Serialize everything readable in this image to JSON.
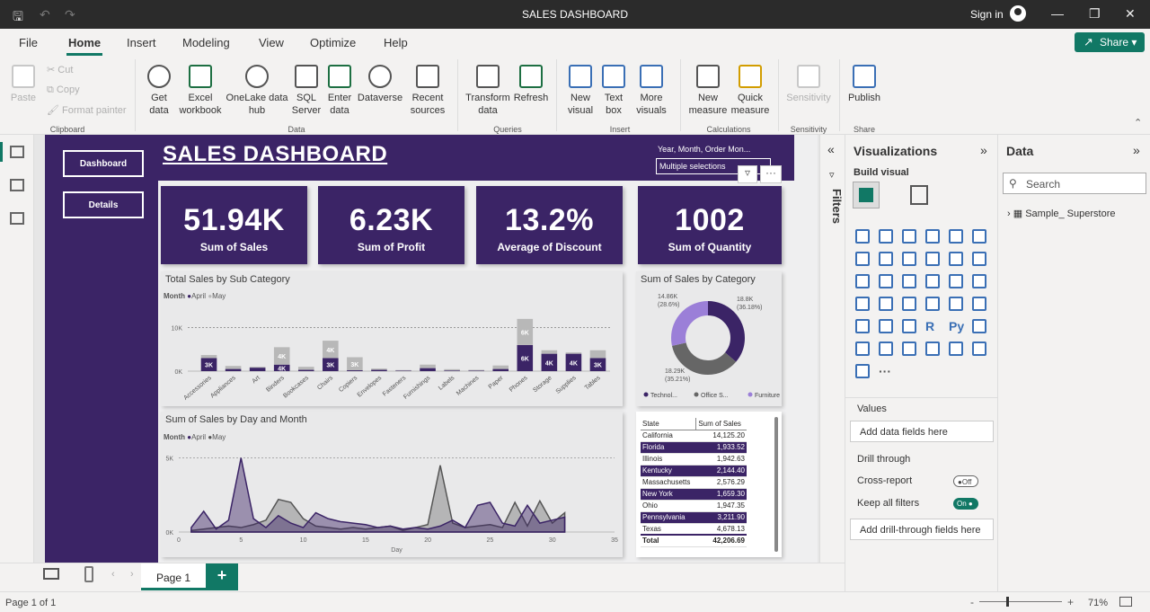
{
  "window": {
    "title": "SALES DASHBOARD",
    "sign_in": "Sign in"
  },
  "menu": {
    "tabs": [
      "File",
      "Home",
      "Insert",
      "Modeling",
      "View",
      "Optimize",
      "Help"
    ],
    "share": "Share"
  },
  "ribbon": {
    "clipboard": {
      "paste": "Paste",
      "cut": "Cut",
      "copy": "Copy",
      "format_painter": "Format painter",
      "group": "Clipboard"
    },
    "data": {
      "get_data": "Get data",
      "excel": "Excel workbook",
      "onelake": "OneLake data hub",
      "sql": "SQL Server",
      "enter": "Enter data",
      "dataverse": "Dataverse",
      "recent": "Recent sources",
      "group": "Data"
    },
    "queries": {
      "transform": "Transform data",
      "refresh": "Refresh",
      "group": "Queries"
    },
    "insert": {
      "new_visual": "New visual",
      "text_box": "Text box",
      "more_visuals": "More visuals",
      "group": "Insert"
    },
    "calculations": {
      "new_measure": "New measure",
      "quick_measure": "Quick measure",
      "group": "Calculations"
    },
    "sensitivity": {
      "label": "Sensitivity",
      "group": "Sensitivity"
    },
    "share": {
      "publish": "Publish",
      "group": "Share"
    }
  },
  "report": {
    "nav": {
      "dashboard": "Dashboard",
      "details": "Details"
    },
    "title": "SALES  DASHBOARD",
    "slicer": {
      "label": "Year, Month, Order Mon...",
      "value": "Multiple selections"
    },
    "kpis": [
      {
        "value": "51.94K",
        "label": "Sum of Sales"
      },
      {
        "value": "6.23K",
        "label": "Sum of Profit"
      },
      {
        "value": "13.2%",
        "label": "Average of Discount"
      },
      {
        "value": "1002",
        "label": "Sum of Quantity"
      }
    ]
  },
  "chart_data": [
    {
      "type": "bar",
      "title": "Total Sales by Sub Category",
      "legend_title": "Month",
      "stacked": true,
      "categories": [
        "Accessories",
        "Appliances",
        "Art",
        "Binders",
        "Bookcases",
        "Chairs",
        "Copiers",
        "Envelopes",
        "Fasteners",
        "Furnishings",
        "Labels",
        "Machines",
        "Paper",
        "Phones",
        "Storage",
        "Supplies",
        "Tables"
      ],
      "series": [
        {
          "name": "April",
          "color": "#3b2466",
          "values": [
            3000,
            500,
            800,
            1500,
            300,
            3000,
            200,
            300,
            100,
            700,
            150,
            100,
            500,
            6000,
            4000,
            4000,
            3000
          ]
        },
        {
          "name": "May",
          "color": "#b8b8b8",
          "values": [
            700,
            700,
            200,
            4000,
            700,
            4000,
            3000,
            300,
            150,
            800,
            300,
            200,
            800,
            6000,
            800,
            300,
            1800
          ]
        }
      ],
      "data_labels": [
        "3K",
        "",
        "",
        "4K",
        "",
        "3K",
        "",
        "",
        "",
        "",
        "",
        "",
        "",
        "6K",
        "4K",
        "4K",
        "3K"
      ],
      "data_labels_may": [
        "",
        "",
        "",
        "4K",
        "",
        "4K",
        "3K",
        "",
        "",
        "",
        "",
        "",
        "",
        "6K",
        "",
        "",
        ""
      ],
      "yticks": [
        "0K",
        "10K"
      ],
      "ylim": [
        0,
        14000
      ]
    },
    {
      "type": "pie",
      "title": "Sum of Sales by Category",
      "donut": true,
      "slices": [
        {
          "name": "Technol...",
          "value": 18800,
          "percent": "36.18%",
          "label": "18.8K",
          "color": "#3b2466"
        },
        {
          "name": "Office S...",
          "value": 18290,
          "percent": "35.21%",
          "label": "18.29K",
          "color": "#666666"
        },
        {
          "name": "Furniture",
          "value": 14860,
          "percent": "28.6%",
          "label": "14.86K",
          "color": "#9b7fd8"
        }
      ]
    },
    {
      "type": "area",
      "title": "Sum of Sales by Day and Month",
      "legend_title": "Month",
      "xlabel": "Day",
      "xticks": [
        0,
        5,
        10,
        15,
        20,
        25,
        30,
        35
      ],
      "yticks": [
        "0K",
        "5K"
      ],
      "xlim": [
        0,
        35
      ],
      "ylim": [
        0,
        6000
      ],
      "x": [
        1,
        2,
        3,
        4,
        5,
        6,
        7,
        8,
        9,
        10,
        11,
        12,
        13,
        14,
        15,
        16,
        17,
        18,
        19,
        20,
        21,
        22,
        23,
        24,
        25,
        26,
        27,
        28,
        29,
        30,
        31
      ],
      "series": [
        {
          "name": "April",
          "color": "#3b2466",
          "values": [
            300,
            1400,
            200,
            800,
            5000,
            900,
            300,
            1100,
            600,
            300,
            1300,
            900,
            700,
            600,
            500,
            300,
            400,
            200,
            300,
            200,
            400,
            800,
            300,
            1800,
            2000,
            600,
            400,
            1800,
            600,
            800,
            1000
          ]
        },
        {
          "name": "May",
          "color": "#555555",
          "values": [
            100,
            200,
            300,
            400,
            300,
            500,
            800,
            2200,
            2000,
            900,
            400,
            300,
            200,
            300,
            200,
            300,
            400,
            100,
            300,
            500,
            4500,
            600,
            300,
            400,
            500,
            300,
            2000,
            400,
            2100,
            600,
            1300
          ]
        }
      ]
    }
  ],
  "state_table": {
    "headers": [
      "State",
      "Sum of Sales"
    ],
    "rows": [
      [
        "California",
        "14,125.20"
      ],
      [
        "Florida",
        "1,933.52"
      ],
      [
        "Illinois",
        "1,942.63"
      ],
      [
        "Kentucky",
        "2,144.40"
      ],
      [
        "Massachusetts",
        "2,576.29"
      ],
      [
        "New York",
        "1,659.30"
      ],
      [
        "Ohio",
        "1,947.35"
      ],
      [
        "Pennsylvania",
        "3,211.90"
      ],
      [
        "Texas",
        "4,678.13"
      ]
    ],
    "total": [
      "Total",
      "42,206.69"
    ]
  },
  "panes": {
    "filters": "Filters",
    "visualizations": {
      "title": "Visualizations",
      "build": "Build visual",
      "values_label": "Values",
      "values_placeholder": "Add data fields here",
      "drill_through": "Drill through",
      "cross_report": "Cross-report",
      "cross_report_state": "Off",
      "keep_filters": "Keep all filters",
      "keep_filters_state": "On",
      "drill_placeholder": "Add drill-through fields here",
      "r_label": "R",
      "py_label": "Py",
      "more": "···"
    },
    "data": {
      "title": "Data",
      "search_placeholder": "Search",
      "table": "Sample_ Superstore"
    }
  },
  "pages": {
    "tab": "Page 1",
    "add": "+"
  },
  "status": {
    "page": "Page 1 of 1",
    "zoom": "71%"
  }
}
